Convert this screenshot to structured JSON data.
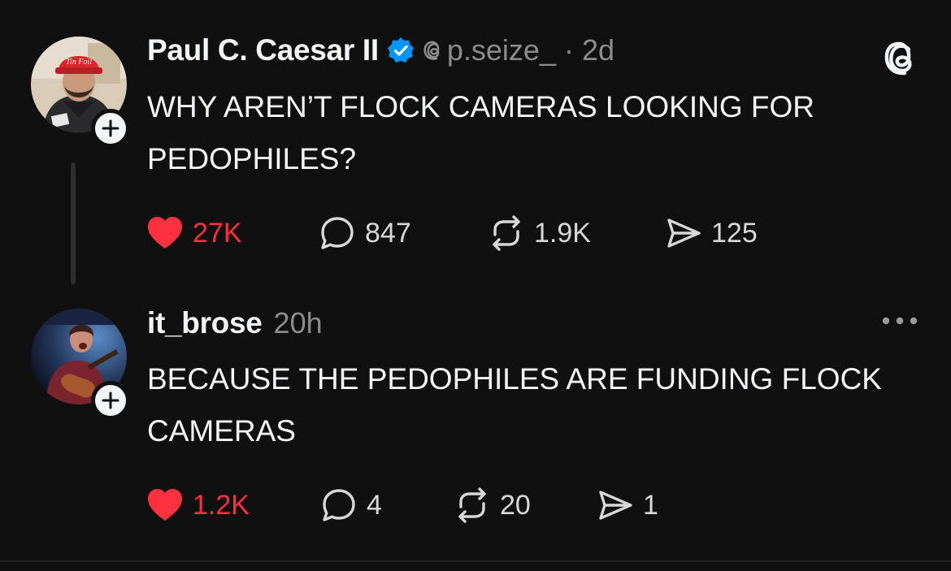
{
  "colors": {
    "background": "#101010",
    "text_primary": "#f3f5f7",
    "text_secondary": "#8c8c8c",
    "like_red": "#ff3040",
    "verified_blue": "#0095f6"
  },
  "post": {
    "username": "Paul C. Caesar II",
    "verified": true,
    "handle": "p.seize_",
    "separator": "·",
    "time": "2d",
    "text": "WHY AREN’T FLOCK CAMERAS LOOKING FOR PEDOPHILES?",
    "avatar_hat_text": "Tin Foil",
    "liked": true,
    "likes": "27K",
    "replies": "847",
    "reposts": "1.9K",
    "shares": "125",
    "icons": {
      "avatar": "user-avatar",
      "follow": "plus-icon",
      "verified": "verified-badge-icon",
      "handle_prefix": "threads-at-icon",
      "app_logo": "threads-logo-icon",
      "like": "heart-icon",
      "reply": "comment-bubble-icon",
      "repost": "repost-icon",
      "share": "send-icon"
    }
  },
  "reply": {
    "username": "it_brose",
    "time": "20h",
    "text": "BECAUSE THE PEDOPHILES ARE FUNDING FLOCK CAMERAS",
    "liked": true,
    "likes": "1.2K",
    "replies": "4",
    "reposts": "20",
    "shares": "1",
    "icons": {
      "avatar": "user-avatar",
      "follow": "plus-icon",
      "more": "more-dots-icon",
      "like": "heart-icon",
      "reply": "comment-bubble-icon",
      "repost": "repost-icon",
      "share": "send-icon"
    }
  }
}
